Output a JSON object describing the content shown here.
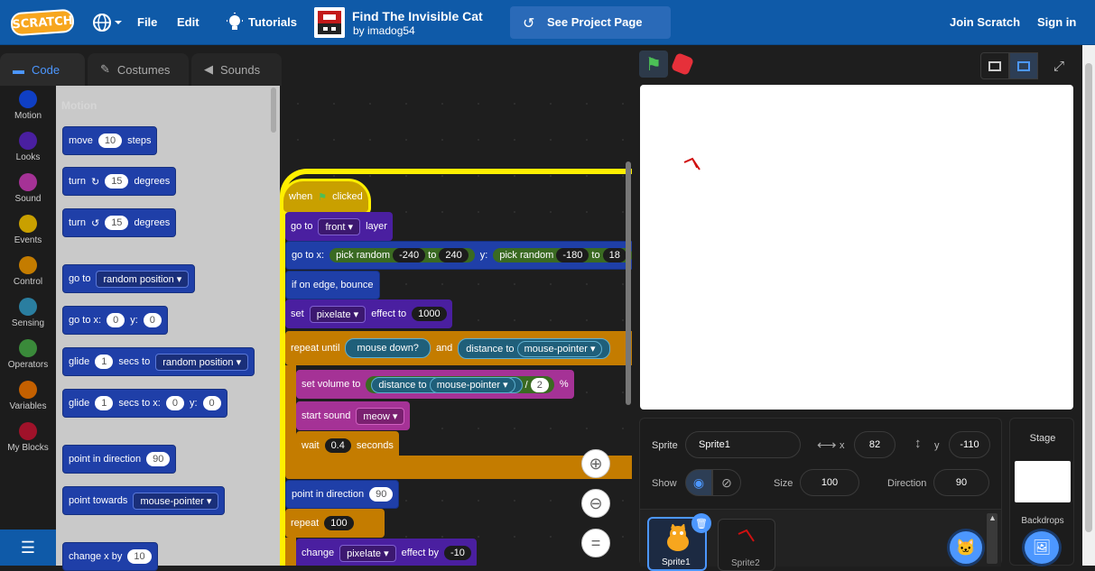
{
  "header": {
    "logo": "SCRATCH",
    "menu_file": "File",
    "menu_edit": "Edit",
    "menu_tutorials": "Tutorials",
    "project_title": "Find The Invisible Cat",
    "project_author": "by imadog54",
    "see_project": "See Project Page",
    "join": "Join Scratch",
    "signin": "Sign in"
  },
  "tabs": {
    "code": "Code",
    "costumes": "Costumes",
    "sounds": "Sounds"
  },
  "categories": [
    {
      "label": "Motion",
      "color": "#0f3fc4"
    },
    {
      "label": "Looks",
      "color": "#4a1fa0"
    },
    {
      "label": "Sound",
      "color": "#a53296"
    },
    {
      "label": "Events",
      "color": "#c9a000"
    },
    {
      "label": "Control",
      "color": "#c47c00"
    },
    {
      "label": "Sensing",
      "color": "#2a7ea0"
    },
    {
      "label": "Operators",
      "color": "#3a8a3a"
    },
    {
      "label": "Variables",
      "color": "#c46000"
    },
    {
      "label": "My Blocks",
      "color": "#a0122a"
    }
  ],
  "palette": {
    "heading": "Motion",
    "move": "move",
    "move_val": "10",
    "steps": "steps",
    "turn": "turn",
    "turn_val": "15",
    "degrees": "degrees",
    "goto": "go to",
    "random_position": "random position",
    "gotoxy": "go to x:",
    "x0": "0",
    "y_label": "y:",
    "y0": "0",
    "glide": "glide",
    "one": "1",
    "secs_to": "secs to",
    "secs_to_x": "secs to x:",
    "point_dir": "point in direction",
    "ninety": "90",
    "point_towards": "point towards",
    "mouse_pointer": "mouse-pointer",
    "change_x": "change x by",
    "ten": "10"
  },
  "script": {
    "when": "when",
    "clicked": "clicked",
    "goto": "go to",
    "front": "front",
    "layer": "layer",
    "gotox": "go to x:",
    "pick_random": "pick random",
    "neg240": "-240",
    "to": "to",
    "p240": "240",
    "y": "y:",
    "neg180": "-180",
    "trunc": "18",
    "bounce": "if on edge, bounce",
    "set": "set",
    "pixelate": "pixelate",
    "effect_to": "effect to",
    "thousand": "1000",
    "repeat_until": "repeat until",
    "mouse_down": "mouse down?",
    "and": "and",
    "distance_to": "distance to",
    "mouse_pointer": "mouse-pointer",
    "set_volume": "set volume to",
    "div": "/",
    "two": "2",
    "pct": "%",
    "start_sound": "start sound",
    "meow": "meow",
    "wait": "wait",
    "wait_val": "0.4",
    "seconds": "seconds",
    "point_dir": "point in direction",
    "ninety": "90",
    "repeat": "repeat",
    "hundred": "100",
    "change": "change",
    "effect_by": "effect by",
    "neg10": "-10"
  },
  "sprite_info": {
    "sprite_label": "Sprite",
    "sprite_name": "Sprite1",
    "x_label": "x",
    "x_val": "82",
    "y_label": "y",
    "y_val": "-110",
    "show_label": "Show",
    "size_label": "Size",
    "size_val": "100",
    "direction_label": "Direction",
    "direction_val": "90"
  },
  "sprites": [
    "Sprite1",
    "Sprite2"
  ],
  "stage_panel": {
    "title": "Stage",
    "backdrops": "Backdrops"
  }
}
